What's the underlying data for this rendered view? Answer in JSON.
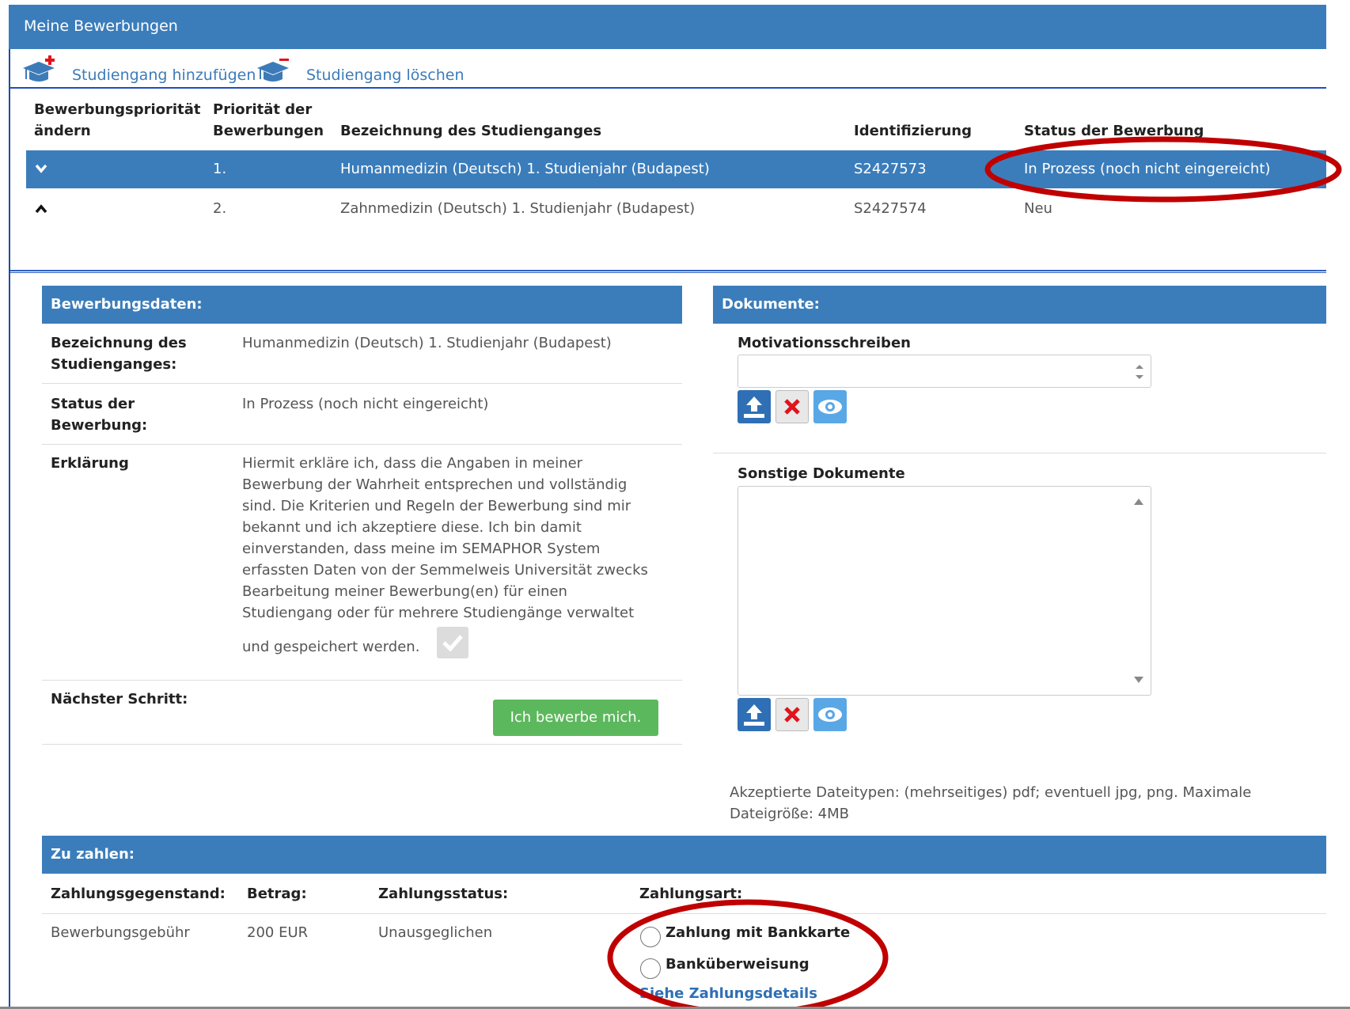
{
  "header": {
    "title": "Meine Bewerbungen"
  },
  "toolbar": {
    "add_label": "Studiengang hinzufügen",
    "delete_label": "Studiengang löschen"
  },
  "table": {
    "headers": {
      "change_priority": "Bewerbungspriorität ändern",
      "priority": "Priorität der Bewerbungen",
      "program": "Bezeichnung des Studienganges",
      "id": "Identifizierung",
      "status": "Status der Bewerbung"
    },
    "rows": [
      {
        "priority": "1.",
        "program": "Humanmedizin (Deutsch) 1. Studienjahr (Budapest)",
        "id": "S2427573",
        "status": "In Prozess (noch nicht eingereicht)"
      },
      {
        "priority": "2.",
        "program": "Zahnmedizin (Deutsch) 1. Studienjahr (Budapest)",
        "id": "S2427574",
        "status": "Neu"
      }
    ]
  },
  "application_data": {
    "heading": "Bewerbungsdaten:",
    "program_label": "Bezeichnung des Studienganges:",
    "program_value": "Humanmedizin (Deutsch) 1. Studienjahr (Budapest)",
    "status_label": "Status der Bewerbung:",
    "status_value": "In Prozess (noch nicht eingereicht)",
    "declaration_label": "Erklärung",
    "declaration_lines": [
      "Hiermit erkläre ich, dass die Angaben in meiner",
      "Bewerbung der Wahrheit entsprechen und vollständig",
      "sind. Die Kriterien und Regeln der Bewerbung sind mir",
      "bekannt und ich akzeptiere diese. Ich bin damit",
      "einverstanden, dass meine im SEMAPHOR System",
      "erfassten Daten von der Semmelweis Universität zwecks",
      "Bearbeitung meiner Bewerbung(en) für einen",
      "Studiengang oder für mehrere Studiengänge verwaltet"
    ],
    "declaration_last": "und gespeichert werden.",
    "next_step_label": "Nächster Schritt:",
    "apply_button": "Ich bewerbe mich."
  },
  "documents": {
    "heading": "Dokumente:",
    "motivation_label": "Motivationsschreiben",
    "other_label": "Sonstige Dokumente",
    "accepted_line1": "Akzeptierte Dateitypen: (mehrseitiges) pdf; eventuell jpg, png. Maximale",
    "accepted_line2": "Dateigröße: 4MB"
  },
  "payment": {
    "heading": "Zu zahlen:",
    "headers": {
      "item": "Zahlungsgegenstand:",
      "amount": "Betrag:",
      "status": "Zahlungsstatus:",
      "method": "Zahlungsart:"
    },
    "row": {
      "item": "Bewerbungsgebühr",
      "amount": "200 EUR",
      "status": "Unausgeglichen"
    },
    "option_card": "Zahlung mit Bankkarte",
    "option_transfer": "Banküberweisung",
    "details_link": "Siehe Zahlungsdetails"
  },
  "colors": {
    "header_blue": "#3b7dbb",
    "highlight_ellipse": "#c00000",
    "apply_green": "#5cb85c"
  }
}
